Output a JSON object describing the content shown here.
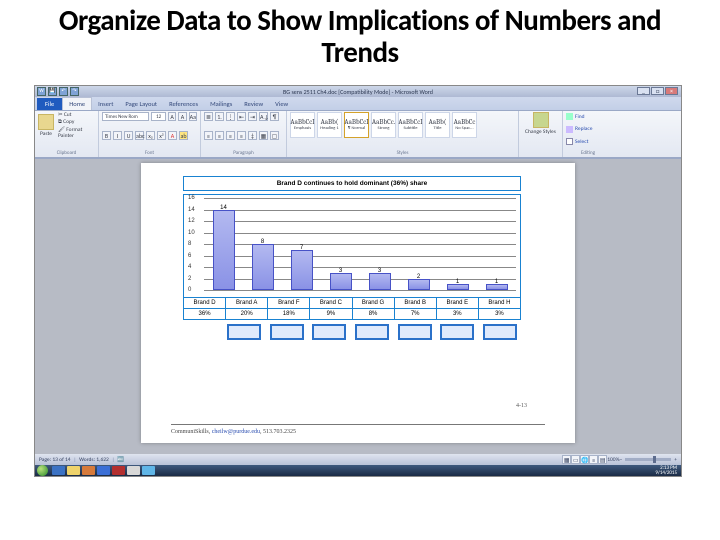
{
  "slide": {
    "title": "Organize Data to Show Implications of Numbers and Trends"
  },
  "window": {
    "title": "BG sens 2511 Ch4.doc [Compatibility Mode] - Microsoft Word",
    "tabs": [
      "File",
      "Home",
      "Insert",
      "Page Layout",
      "References",
      "Mailings",
      "Review",
      "View"
    ],
    "active_tab": 1,
    "clipboard": {
      "paste": "Paste",
      "cut": "Cut",
      "copy": "Copy",
      "fmt": "Format Painter",
      "label": "Clipboard"
    },
    "font": {
      "family": "Times New Rom",
      "size": "12",
      "b": "B",
      "i": "I",
      "u": "U",
      "label": "Font"
    },
    "paragraph": {
      "label": "Paragraph"
    },
    "styles": {
      "label": "Styles",
      "tiles": [
        {
          "prev": "AaBbCcI",
          "name": "Emphasis"
        },
        {
          "prev": "AaBb(",
          "name": "Heading 1"
        },
        {
          "prev": "AaBbCcI",
          "name": "¶ Normal"
        },
        {
          "prev": "AaBbCc.",
          "name": "Strong"
        },
        {
          "prev": "AaBbCcI",
          "name": "Subtitle"
        },
        {
          "prev": "AaBb(",
          "name": "Title"
        },
        {
          "prev": "AaBbCc",
          "name": "No Spac..."
        }
      ],
      "change": "Change Styles"
    },
    "editing": {
      "find": "Find",
      "replace": "Replace",
      "select": "Select",
      "label": "Editing"
    }
  },
  "doc": {
    "page_number": "4-13",
    "contact": {
      "text": "CommuniSkills, ",
      "link": "cheilw@purdue.edu",
      "phone": ", 513.703.2325"
    }
  },
  "status": {
    "pg": "Page: 13 of 14",
    "wd": "Words: 1,622",
    "lang": "",
    "zoom": "100%"
  },
  "clock": {
    "time": "2:13 PM",
    "date": "9/14/2015"
  },
  "chart_data": {
    "type": "bar",
    "title": "Brand D continues to hold dominant (36%) share",
    "categories": [
      "Brand D",
      "Brand A",
      "Brand F",
      "Brand C",
      "Brand G",
      "Brand B",
      "Brand E",
      "Brand H"
    ],
    "values": [
      14,
      8,
      7,
      3,
      3,
      2,
      1,
      1
    ],
    "percent_row": [
      "36%",
      "20%",
      "18%",
      "9%",
      "8%",
      "7%",
      "3%",
      "3%"
    ],
    "y_ticks": [
      0,
      2,
      4,
      6,
      8,
      10,
      12,
      14,
      16
    ],
    "ylim": [
      0,
      16
    ]
  }
}
